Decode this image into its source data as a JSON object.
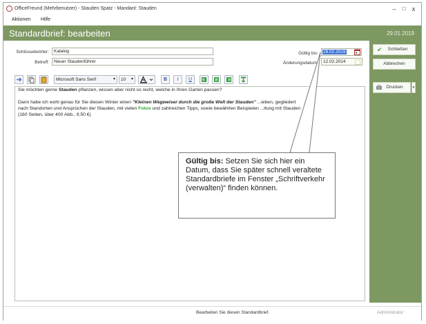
{
  "window": {
    "title": "OfficeFreund (Mehrbenutzer)  -  Stauden Spatz  -  Mandant: Stauden",
    "minimize": "–",
    "maximize": "□",
    "close": "x"
  },
  "menu": [
    "Aktionen",
    "Hilfe"
  ],
  "header": {
    "title": "Standardbrief: bearbeiten",
    "date": "29.01.2019"
  },
  "form": {
    "keywords_label": "Schlüsselwörter:",
    "keywords_value": "Katalog",
    "subject_label": "Betreff:",
    "subject_value": "Neuer Staudenführer",
    "valid_until_label": "Gültig bis:",
    "valid_until_value": "28.02.2019",
    "changed_date_label": "Änderungsdatum:",
    "changed_date_value": "12.02.2014"
  },
  "toolbar": {
    "font_name": "Microsoft Sans Serif",
    "font_size": "10",
    "bold": "B",
    "italic": "I",
    "underline": "U"
  },
  "editor": {
    "line1_a": "Sie möchten gerne ",
    "line1_b": "Stauden",
    "line1_c": " pflanzen, wissen aber nicht so recht, welche in Ihren Garten passen?",
    "line2_a": "Dann habe ich wohl genau für Sie diesen Winter einen  ",
    "line2_b": "\"Kleinen Wegweiser durch die große Welt der Stauden\"",
    "line2_c": " ...ieben, gegliedert",
    "line3_a": "nach Standorten und Ansprüchen der Stauden, mit vielen ",
    "line3_b": "Fotos",
    "line3_c": " und zahlreichen Tipps, sowie bewährten Beispielen ...ltung mit Stauden",
    "line4": "(160 Seiten, über 400 Abb., 9,50 €)"
  },
  "sidebar": {
    "close": "Schließen",
    "cancel": "Abbrechen",
    "print": "Drucken"
  },
  "status": {
    "message": "Bearbeiten Sie diesen Standardbrief.",
    "user": "Administrator"
  },
  "callout": {
    "title": "Gültig bis:",
    "text": " Setzen Sie sich hier ein Datum, dass Sie später schnell veraltete Standardbriefe im Fenster „Schriftverkehr (verwalten)“ finden können."
  },
  "colors": {
    "accent": "#7e9862",
    "link_green": "#2aa52a",
    "selected_date_bg": "#3b6fd4"
  }
}
